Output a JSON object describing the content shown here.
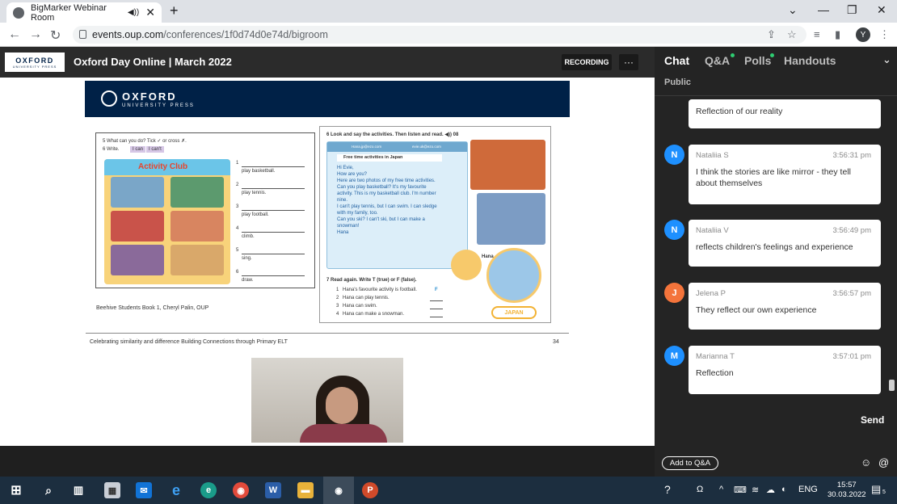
{
  "browser": {
    "tab_title": "BigMarker Webinar Room",
    "url_host": "events.oup.com",
    "url_path": "/conferences/1f0d74d0e74d/bigroom",
    "profile_initial": "Y"
  },
  "header": {
    "logo_text": "OXFORD",
    "logo_sub": "UNIVERSITY PRESS",
    "event_title": "Oxford Day Online | March 2022",
    "recording_label": "RECORDING",
    "more_label": "···"
  },
  "slide": {
    "banner_title": "OXFORD",
    "banner_sub": "UNIVERSITY PRESS",
    "left": {
      "ex5": "5  What can you do? Tick ✓ or cross ✗.",
      "ex6": "6  Write.",
      "chip_can": "I can",
      "chip_cant": "I can't",
      "club_title": "Activity Club",
      "items": [
        {
          "num": "1",
          "text": "play basketball."
        },
        {
          "num": "2",
          "text": "play tennis."
        },
        {
          "num": "3",
          "text": "play football."
        },
        {
          "num": "4",
          "text": "climb."
        },
        {
          "num": "5",
          "text": "sing."
        },
        {
          "num": "6",
          "text": "draw."
        }
      ]
    },
    "right": {
      "ex6": "6  Look and say the activities. Then listen and read. ◀)) 08",
      "from": "Hana.jp@ezo.com",
      "to": "evie.uk@ezo.com",
      "subject": "Free time activities in Japan",
      "letter": [
        "Hi Evie,",
        "How are you?",
        "Here are two photos of my free time activities.",
        "Can you play basketball? It's my favourite",
        "activity. This is my basketball club. I'm number",
        "nine.",
        "I can't play tennis, but I can swim. I can sledge",
        "with my family, too.",
        "Can you ski? I can't ski, but I can make a",
        "snowman!",
        "Hana"
      ],
      "hana_label": "Hana",
      "ex7": "7  Read again. Write T (true) or F (false).",
      "tf": [
        {
          "num": "1",
          "text": "Hana's favourite activity is football.",
          "answer": "F"
        },
        {
          "num": "2",
          "text": "Hana can play tennis.",
          "answer": ""
        },
        {
          "num": "3",
          "text": "Hana can swim.",
          "answer": ""
        },
        {
          "num": "4",
          "text": "Hana can make a snowman.",
          "answer": ""
        }
      ],
      "japan_label": "JAPAN"
    },
    "caption": "Beehive Students Book 1, Cheryl Palin, OUP",
    "footer_text": "Celebrating similarity and difference  Building Connections through Primary ELT",
    "page_number": "34"
  },
  "chat": {
    "tabs": {
      "chat": "Chat",
      "qa": "Q&A",
      "polls": "Polls",
      "handouts": "Handouts"
    },
    "public_label": "Public",
    "messages": [
      {
        "initial": "",
        "name": "",
        "time": "",
        "text": "Reflection of our reality",
        "color": "#1e90ff"
      },
      {
        "initial": "N",
        "name": "Nataliia S",
        "time": "3:56:31 pm",
        "text": "I think the stories are like mirror - they tell about themselves",
        "color": "#1e90ff"
      },
      {
        "initial": "N",
        "name": "Nataliia V",
        "time": "3:56:49 pm",
        "text": "reflects children's feelings  and experience",
        "color": "#1e90ff"
      },
      {
        "initial": "J",
        "name": "Jelena P",
        "time": "3:56:57 pm",
        "text": "They reflect our own experience",
        "color": "#f4743b"
      },
      {
        "initial": "M",
        "name": "Marianna T",
        "time": "3:57:01 pm",
        "text": " Reflection",
        "color": "#1e90ff"
      }
    ],
    "send_label": "Send",
    "add_qa_label": "Add to Q&A"
  },
  "taskbar": {
    "lang": "ENG",
    "time": "15:57",
    "date": "30.03.2022",
    "notif_count": "5"
  }
}
